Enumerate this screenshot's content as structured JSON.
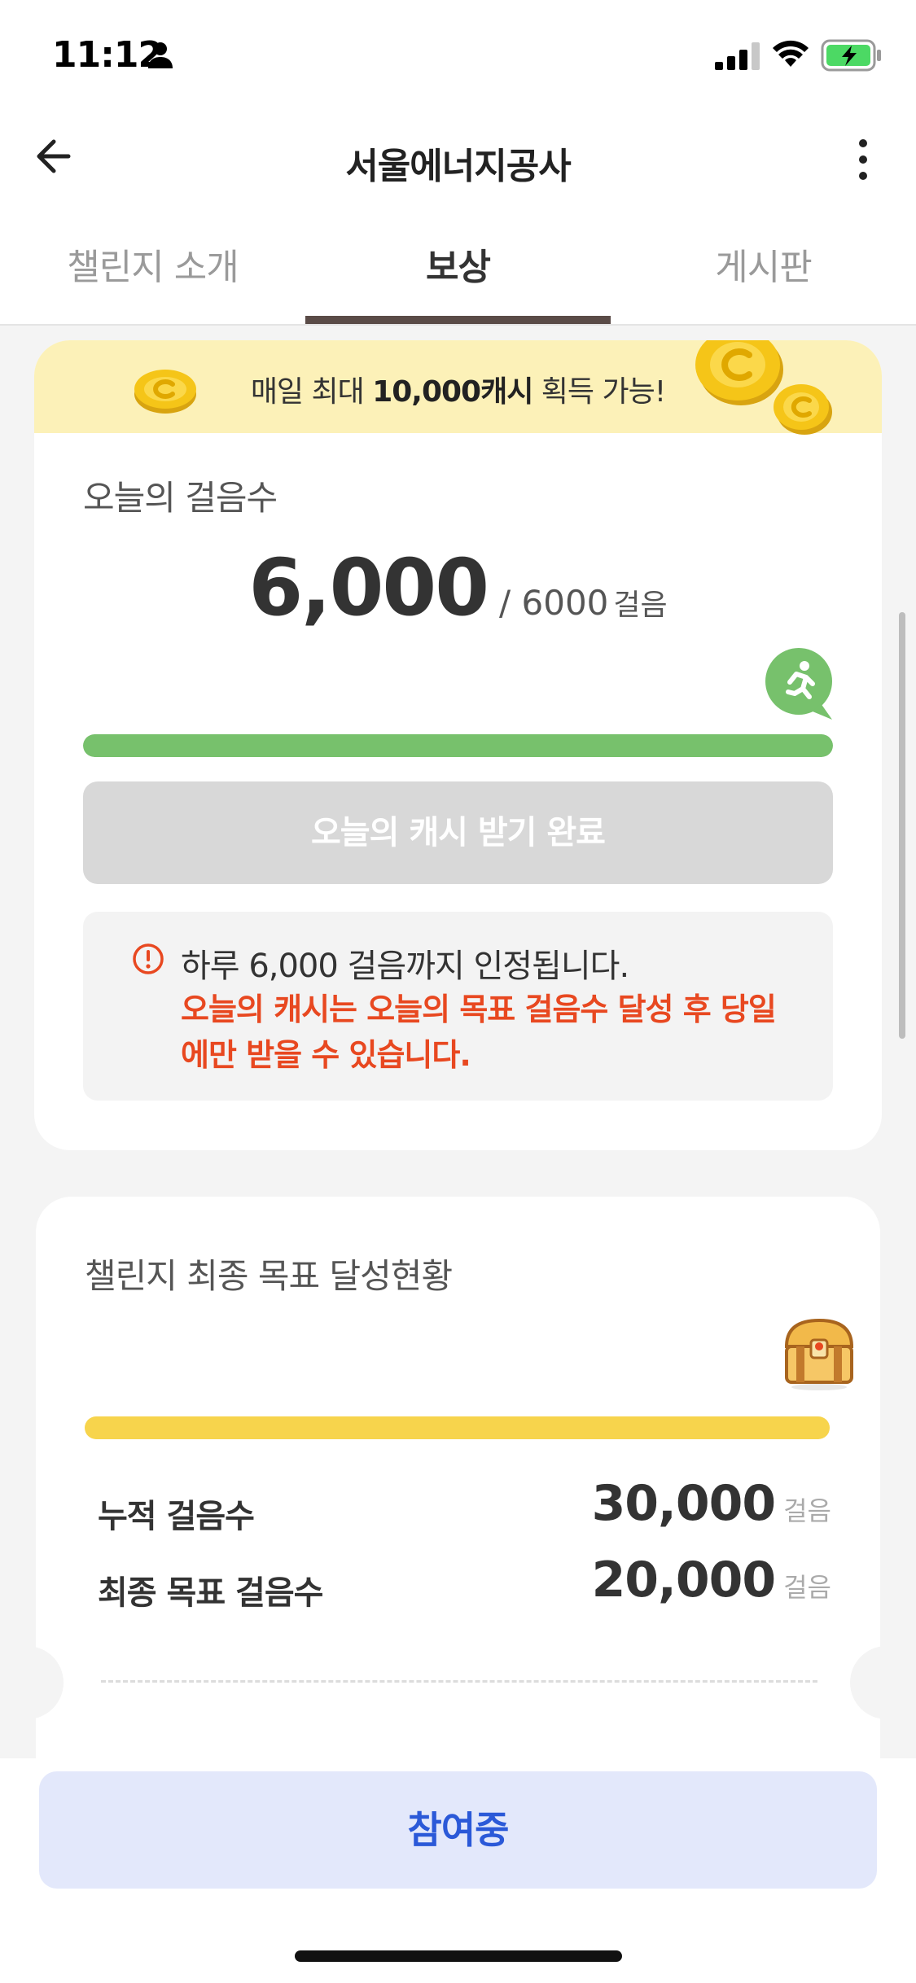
{
  "status_bar": {
    "time": "11:12"
  },
  "header": {
    "title": "서울에너지공사"
  },
  "tabs": [
    {
      "label": "챌린지 소개",
      "active": false
    },
    {
      "label": "보상",
      "active": true
    },
    {
      "label": "게시판",
      "active": false
    }
  ],
  "banner": {
    "prefix": "매일 최대 ",
    "highlight": "10,000캐시",
    "suffix": " 획득 가능!"
  },
  "today": {
    "label": "오늘의 걸음수",
    "steps": "6,000",
    "goal": "/ 6000",
    "unit": "걸음",
    "progress_fraction": 1.0,
    "progress_color": "#77c16c",
    "button_label": "오늘의 캐시 받기 완료"
  },
  "notice": {
    "line1": "하루 6,000 걸음까지 인정됩니다.",
    "line2": "오늘의 캐시는 오늘의 목표 걸음수 달성 후 당일에만 받을 수 있습니다."
  },
  "challenge": {
    "label": "챌린지 최종 목표 달성현황",
    "progress_fraction": 1.0,
    "progress_color": "#f7d44c",
    "accumulated_label": "누적 걸음수",
    "accumulated_value": "30,000",
    "goal_label": "최종 목표 걸음수",
    "goal_value": "20,000",
    "unit": "걸음"
  },
  "footer": {
    "button_label": "참여중",
    "button_color": "#2b59d8"
  }
}
